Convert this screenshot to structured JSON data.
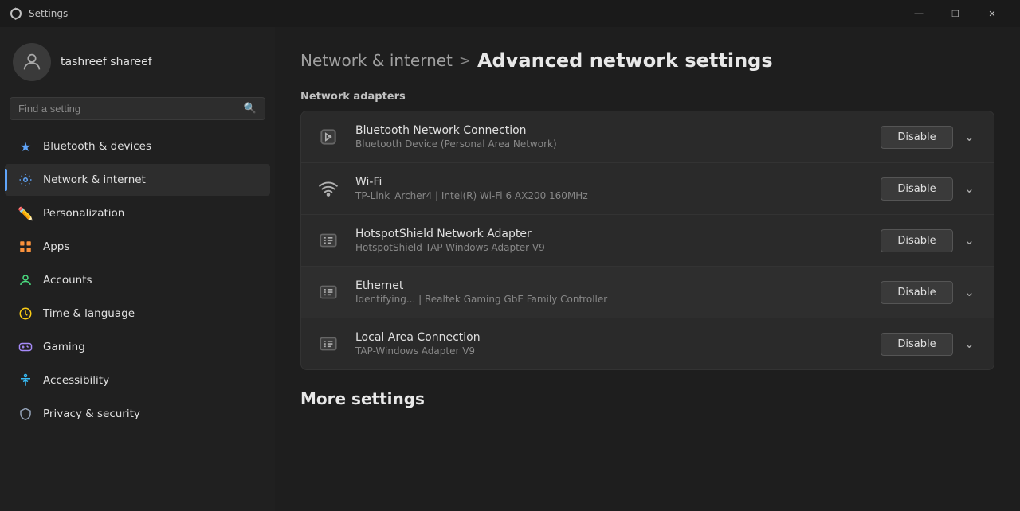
{
  "titlebar": {
    "title": "Settings",
    "min_label": "—",
    "max_label": "❐",
    "close_label": "✕"
  },
  "sidebar": {
    "username": "tashreef shareef",
    "search_placeholder": "Find a setting",
    "nav_items": [
      {
        "id": "bluetooth",
        "label": "Bluetooth & devices",
        "icon": "bluetooth"
      },
      {
        "id": "network",
        "label": "Network & internet",
        "icon": "network",
        "active": true
      },
      {
        "id": "personalization",
        "label": "Personalization",
        "icon": "personalization"
      },
      {
        "id": "apps",
        "label": "Apps",
        "icon": "apps"
      },
      {
        "id": "accounts",
        "label": "Accounts",
        "icon": "accounts"
      },
      {
        "id": "time",
        "label": "Time & language",
        "icon": "time"
      },
      {
        "id": "gaming",
        "label": "Gaming",
        "icon": "gaming"
      },
      {
        "id": "accessibility",
        "label": "Accessibility",
        "icon": "accessibility"
      },
      {
        "id": "privacy",
        "label": "Privacy & security",
        "icon": "privacy"
      }
    ]
  },
  "content": {
    "breadcrumb_parent": "Network & internet",
    "breadcrumb_sep": ">",
    "breadcrumb_current": "Advanced network settings",
    "section_adapters": "Network adapters",
    "adapters": [
      {
        "name": "Bluetooth Network Connection",
        "desc": "Bluetooth Device (Personal Area Network)",
        "type": "bluetooth",
        "btn_label": "Disable"
      },
      {
        "name": "Wi-Fi",
        "desc": "TP-Link_Archer4 | Intel(R) Wi-Fi 6 AX200 160MHz",
        "type": "wifi",
        "btn_label": "Disable"
      },
      {
        "name": "HotspotShield Network Adapter",
        "desc": "HotspotShield TAP-Windows Adapter V9",
        "type": "adapter",
        "btn_label": "Disable"
      },
      {
        "name": "Ethernet",
        "desc": "Identifying... | Realtek Gaming GbE Family Controller",
        "type": "ethernet",
        "btn_label": "Disable",
        "highlighted": true
      },
      {
        "name": "Local Area Connection",
        "desc": "TAP-Windows Adapter V9",
        "type": "adapter",
        "btn_label": "Disable"
      }
    ],
    "more_settings_label": "More settings"
  }
}
